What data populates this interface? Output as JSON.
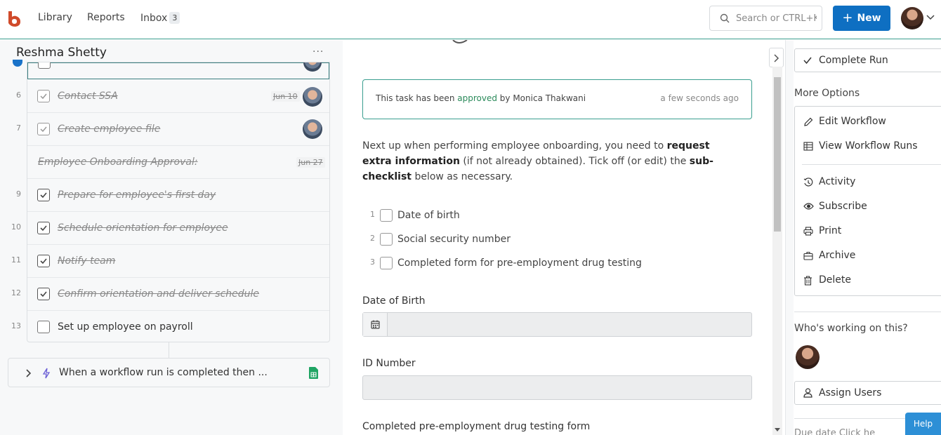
{
  "nav": {
    "library": "Library",
    "reports": "Reports",
    "inbox": "Inbox",
    "inbox_count": "3",
    "search_placeholder": "Search or CTRL+K",
    "new_label": "New"
  },
  "left": {
    "title": "Reshma Shetty",
    "more": "···",
    "tasks": [
      {
        "num": "6",
        "label": "Contact SSA",
        "date": "Jun 10"
      },
      {
        "num": "7",
        "label": "Create employee file"
      },
      {
        "num": "",
        "label": "Employee Onboarding Approval:",
        "date": "Jun 27"
      },
      {
        "num": "9",
        "label": "Prepare for employee's first day"
      },
      {
        "num": "10",
        "label": "Schedule orientation for employee"
      },
      {
        "num": "11",
        "label": "Notify team"
      },
      {
        "num": "12",
        "label": "Confirm orientation and deliver schedule"
      },
      {
        "num": "13",
        "label": "Set up employee on payroll"
      }
    ],
    "trigger": "When a workflow run is completed then ..."
  },
  "center": {
    "approved_prefix": "This task has been",
    "approved_word": "approved",
    "approved_suffix": "by Monica Thakwani",
    "approved_time": "a few seconds ago",
    "desc_1": "Next up when performing employee onboarding, you need to",
    "desc_b1": "request extra information",
    "desc_2": "(if not already obtained). Tick off (or edit) the",
    "desc_b2": "sub-checklist",
    "desc_3": "below as necessary.",
    "subchecklist": [
      {
        "num": "1",
        "label": "Date of birth"
      },
      {
        "num": "2",
        "label": "Social security number"
      },
      {
        "num": "3",
        "label": "Completed form for pre-employment drug testing"
      }
    ],
    "dob_label": "Date of Birth",
    "id_label": "ID Number",
    "drug_label": "Completed pre-employment drug testing form"
  },
  "right": {
    "complete_run": "Complete Run",
    "more_options": "More Options",
    "options": [
      "Edit Workflow",
      "View Workflow Runs",
      "Activity",
      "Subscribe",
      "Print",
      "Archive",
      "Delete"
    ],
    "working": "Who's working on this?",
    "assign": "Assign Users",
    "due": "Due date       Click he",
    "help": "Help"
  },
  "colors": {
    "accent": "#0e6fc2",
    "approved": "#2a8a5a",
    "border_teal": "#3a9e8f",
    "logo": "#d04a2a"
  }
}
